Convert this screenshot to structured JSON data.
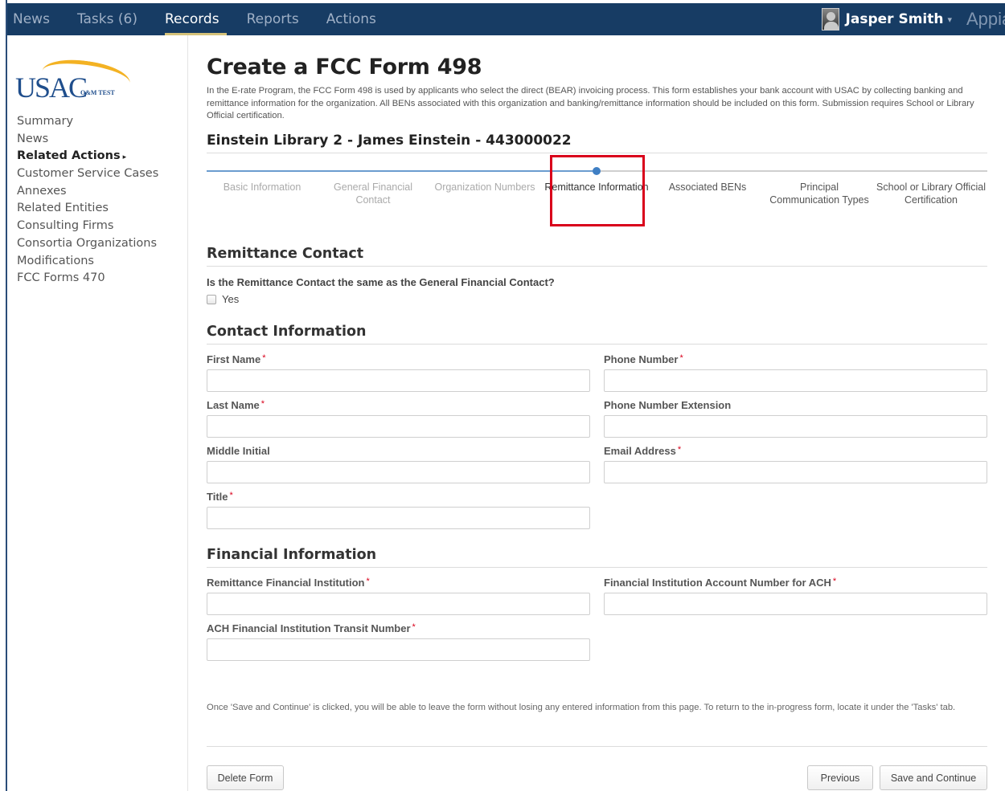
{
  "nav": {
    "tabs": [
      "News",
      "Tasks (6)",
      "Records",
      "Reports",
      "Actions"
    ],
    "active_tab": "Records",
    "user_name": "Jasper Smith",
    "user_caret": "▾",
    "brand": "Appian"
  },
  "sidebar": {
    "logo_text": "USAC",
    "logo_sub": "O&M TEST",
    "items": [
      {
        "label": "Summary"
      },
      {
        "label": "News"
      },
      {
        "label": "Related Actions"
      },
      {
        "label": "Customer Service Cases"
      },
      {
        "label": "Annexes"
      },
      {
        "label": "Related Entities"
      },
      {
        "label": "Consulting Firms"
      },
      {
        "label": "Consortia Organizations"
      },
      {
        "label": "Modifications"
      },
      {
        "label": "FCC Forms 470"
      }
    ]
  },
  "page": {
    "title": "Create a FCC Form 498",
    "intro": "In the E-rate Program, the FCC Form 498 is used by applicants who select the direct (BEAR) invoicing process. This form establishes your bank account with USAC by collecting banking and remittance information for the organization. All BENs associated with this organization and banking/remittance information should be included on this form. Submission requires School or Library Official certification.",
    "org_title": "Einstein Library 2 - James Einstein - 443000022"
  },
  "steps": [
    {
      "label": "Basic Information",
      "state": "done"
    },
    {
      "label": "General Financial Contact",
      "state": "done"
    },
    {
      "label": "Organization Numbers",
      "state": "done"
    },
    {
      "label": "Remittance Information",
      "state": "current"
    },
    {
      "label": "Associated BENs",
      "state": "future"
    },
    {
      "label": "Principal Communication Types",
      "state": "future"
    },
    {
      "label": "School or Library Official Certification",
      "state": "future"
    }
  ],
  "remittance": {
    "title": "Remittance Contact",
    "question": "Is the Remittance Contact the same as the General Financial Contact?",
    "yes_label": "Yes"
  },
  "contact": {
    "title": "Contact Information",
    "first_name": "First Name",
    "last_name": "Last Name",
    "middle_initial": "Middle Initial",
    "title_field": "Title",
    "phone": "Phone Number",
    "phone_ext": "Phone Number Extension",
    "email": "Email Address"
  },
  "financial": {
    "title": "Financial Information",
    "institution": "Remittance Financial Institution",
    "account": "Financial Institution Account Number for ACH",
    "transit": "ACH Financial Institution Transit Number"
  },
  "required_mark": "*",
  "footer": {
    "note": "Once 'Save and Continue' is clicked, you will be able to leave the form without losing any entered information from this page. To return to the in-progress form, locate it under the 'Tasks' tab.",
    "delete_label": "Delete Form",
    "previous_label": "Previous",
    "save_label": "Save and Continue"
  }
}
